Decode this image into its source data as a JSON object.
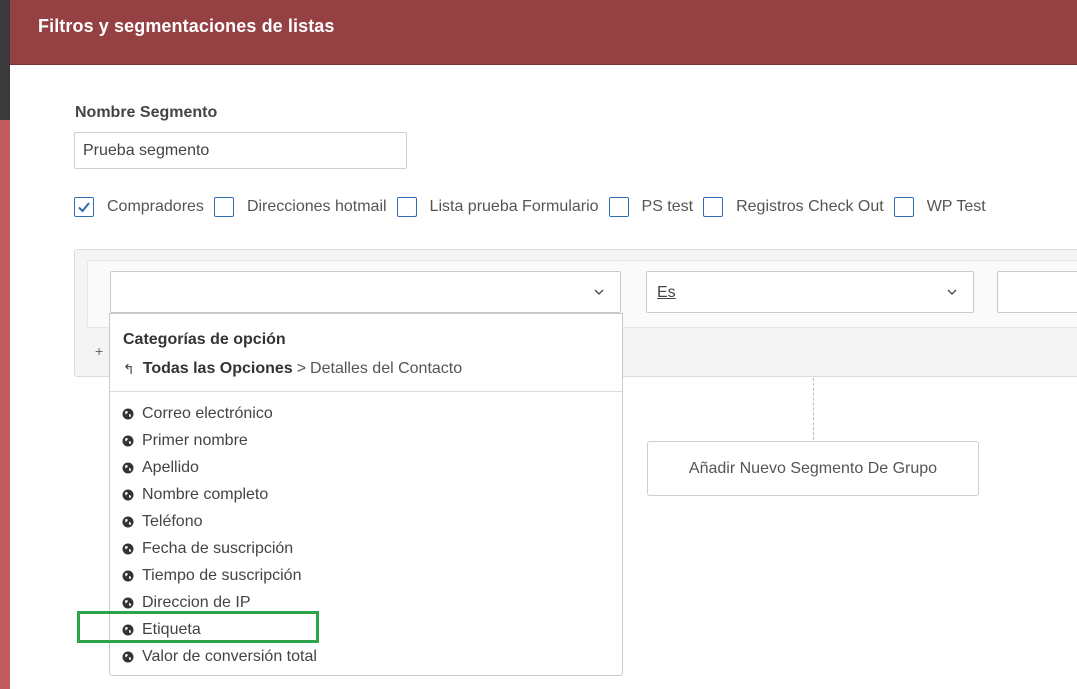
{
  "header": {
    "title": "Filtros y segmentaciones de listas"
  },
  "segment": {
    "name_label": "Nombre Segmento",
    "name_value": "Prueba segmento"
  },
  "lists": [
    {
      "label": "Compradores",
      "checked": true
    },
    {
      "label": "Direcciones hotmail",
      "checked": false
    },
    {
      "label": "Lista prueba Formulario",
      "checked": false
    },
    {
      "label": "PS test",
      "checked": false
    },
    {
      "label": "Registros Check Out",
      "checked": false
    },
    {
      "label": "WP Test",
      "checked": false
    }
  ],
  "rule": {
    "field_value": "",
    "operator_value": "Es",
    "value": "",
    "add_symbol": "+"
  },
  "dropdown": {
    "heading": "Categorías de opción",
    "breadcrumb_root": "Todas las Opciones",
    "breadcrumb_separator": ">",
    "breadcrumb_current": "Detalles del Contacto",
    "options": [
      "Correo electrónico",
      "Primer nombre",
      "Apellido",
      "Nombre completo",
      "Teléfono",
      "Fecha de suscripción",
      "Tiempo de suscripción",
      "Direccion de IP",
      "Etiqueta",
      "Valor de conversión total"
    ],
    "highlighted_option": "Etiqueta"
  },
  "group_button": {
    "label": "Añadir Nuevo Segmento De Grupo"
  },
  "colors": {
    "header_bg": "#954043",
    "sidebar": "#c25c5f",
    "checkbox": "#2f6db5",
    "highlight": "#2ea34a"
  },
  "icons": {
    "option": "globe-icon",
    "back": "back-arrow-icon",
    "select": "chevron-down-icon",
    "check": "checkmark-icon"
  }
}
